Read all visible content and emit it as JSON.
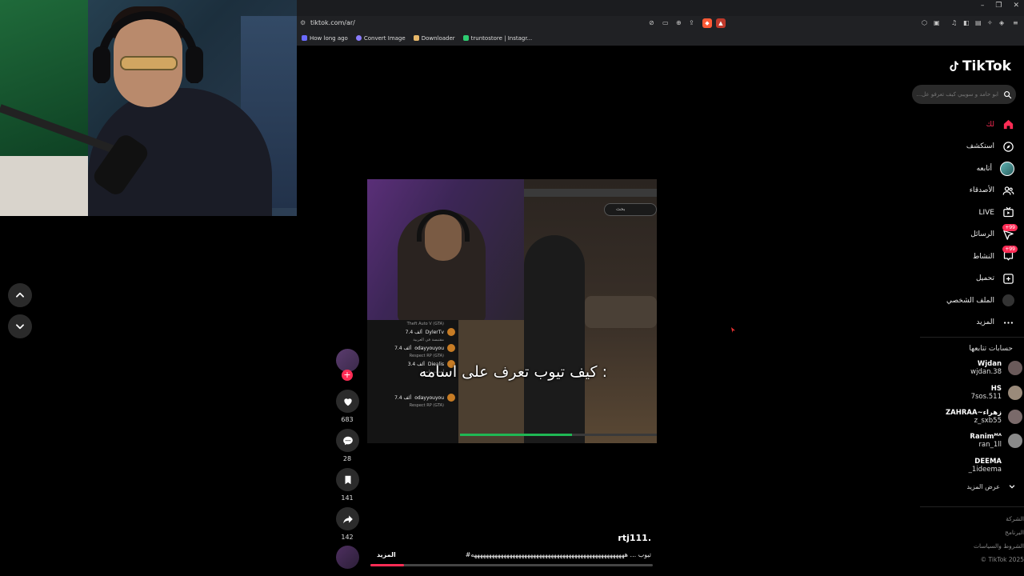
{
  "browser": {
    "url": "tiktok.com/ar/",
    "window_controls": [
      "–",
      "❐",
      "✕"
    ],
    "bookmarks": [
      {
        "label": "How long ago",
        "color": "#6a6aff"
      },
      {
        "label": "Convert Image",
        "color": "#8a7cff"
      },
      {
        "label": "Downloader",
        "color": "#e8b86a"
      },
      {
        "label": "truntostore | Instagr...",
        "color": "#2ecc71"
      }
    ]
  },
  "video": {
    "caption": "كيف تيوب تعرف على اسامه :",
    "search_text": "بحث",
    "chat": [
      {
        "name": "DylerTv",
        "amount": "7.4 ألف",
        "sub": "مقتبسة في العربية"
      },
      {
        "name": "odayyouyou",
        "amount": "7.4 ألف",
        "sub": "Respect RP (GTA)"
      },
      {
        "name": "Diealis",
        "amount": "3.4 ألف",
        "sub": "أحداث حاسمة"
      },
      {
        "name": "odayyouyou",
        "amount": "7.4 ألف",
        "sub": "Respect RP (GTA)"
      }
    ],
    "chat_header": "Theft Auto V (GTA)",
    "progress": 0.57
  },
  "actions": {
    "likes": "683",
    "comments": "28",
    "saves": "141",
    "shares": "142"
  },
  "post": {
    "username": "rtj111.",
    "description": "#تيوب ... ههههههههههههههههههههههههههههههههههههههههههههههههههههه",
    "more_label": "المزيد",
    "progress": 0.12
  },
  "sidebar": {
    "brand": "TikTok",
    "search_placeholder": "ابو حامد و سويبي كيف تعرفو عل...",
    "nav": [
      {
        "label": "لك",
        "icon": "home-icon",
        "active": true
      },
      {
        "label": "استكشف",
        "icon": "compass-icon"
      },
      {
        "label": "أتابعه",
        "icon": "following-avatar"
      },
      {
        "label": "الأصدقاء",
        "icon": "friends-icon"
      },
      {
        "label": "LIVE",
        "icon": "live-icon"
      },
      {
        "label": "الرسائل",
        "icon": "messages-icon",
        "badge": "+99"
      },
      {
        "label": "النشاط",
        "icon": "activity-icon",
        "badge": "+99"
      },
      {
        "label": "تحميل",
        "icon": "upload-icon"
      },
      {
        "label": "الملف الشخصي",
        "icon": "profile-icon"
      },
      {
        "label": "المزيد",
        "icon": "more-icon"
      }
    ],
    "following_title": "حسابات تتابعها",
    "accounts": [
      {
        "name": "Wjdan",
        "handle": "wjdan.38"
      },
      {
        "name": "HS",
        "handle": "7sos.511"
      },
      {
        "name": "ZAHRAA~زهراء",
        "handle": "z_sxb55"
      },
      {
        "name": "Ranimᴹᴬ",
        "handle": "ran_1ll"
      },
      {
        "name": "DEEMA",
        "handle": "_1ideema"
      }
    ],
    "see_more": "عرض المزيد",
    "footer": [
      "الشركة",
      "البرنامج",
      "الشروط والسياسات",
      "© TikTok 2025"
    ]
  },
  "colors": {
    "accent": "#fe2c55",
    "progress_green": "#1fb854"
  }
}
